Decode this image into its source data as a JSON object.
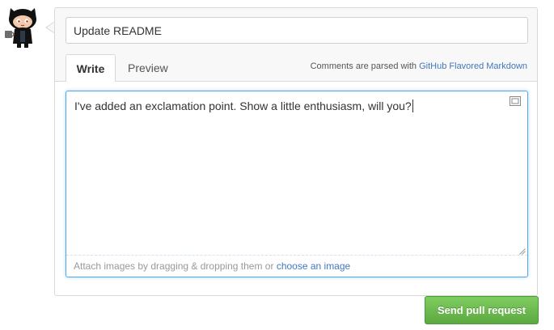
{
  "avatar": {
    "icon": "octocat-avatar-icon"
  },
  "form": {
    "title_value": "Update README",
    "tabs": [
      {
        "label": "Write",
        "active": true
      },
      {
        "label": "Preview",
        "active": false
      }
    ],
    "markdown_note": {
      "prefix": "Comments are parsed with ",
      "link": "GitHub Flavored Markdown"
    },
    "body_value": "I've added an exclamation point. Show a little enthusiasm, will you?",
    "attach": {
      "prefix": "Attach images by dragging & dropping them or ",
      "link": "choose an image"
    }
  },
  "submit_label": "Send pull request",
  "colors": {
    "accent_link": "#4078c0",
    "focus_border": "#51a7e8",
    "button_green": "#6cc644"
  }
}
